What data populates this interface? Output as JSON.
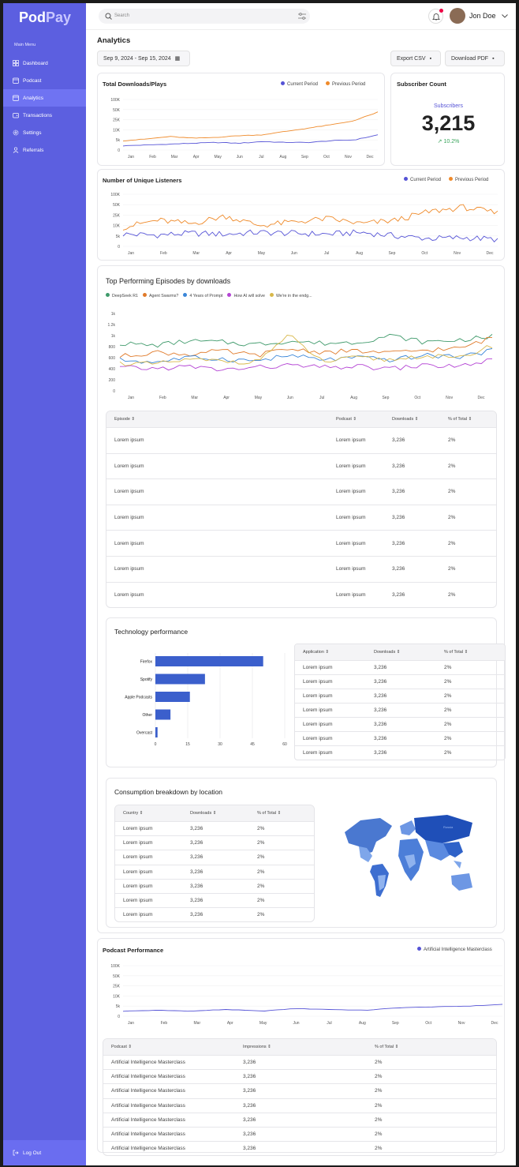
{
  "brand": {
    "name_a": "Pod",
    "name_b": "Pay"
  },
  "sidebar": {
    "menu_title": "Main Menu",
    "items": [
      {
        "label": "Dashboard"
      },
      {
        "label": "Podcast"
      },
      {
        "label": "Analytics"
      },
      {
        "label": "Transactions"
      },
      {
        "label": "Settings"
      },
      {
        "label": "Referrals"
      }
    ],
    "logout": "Log Out"
  },
  "header": {
    "search_placeholder": "Search",
    "user_name": "Jon Doe"
  },
  "page": {
    "title": "Analytics",
    "date_range": "Sep 9, 2024 - Sep 15, 2024",
    "export_csv": "Export CSV",
    "download_pdf": "Download PDF"
  },
  "months": [
    "Jan",
    "Feb",
    "Mar",
    "Apr",
    "May",
    "Jun",
    "Jul",
    "Aug",
    "Sep",
    "Oct",
    "Nov",
    "Dec"
  ],
  "downloads": {
    "title": "Total Downloads/Plays",
    "legend": [
      "Current Period",
      "Previous Period"
    ],
    "yticks": [
      "100K",
      "50K",
      "25K",
      "10K",
      "5k",
      "0"
    ]
  },
  "subscribers": {
    "title": "Subscriber Count",
    "label": "Subscribers",
    "value": "3,215",
    "change": "10.2%"
  },
  "listeners": {
    "title": "Number of Unique Listeners",
    "legend": [
      "Current Period",
      "Previous Period"
    ],
    "yticks": [
      "100K",
      "50K",
      "25K",
      "10K",
      "5k",
      "0"
    ]
  },
  "episodes": {
    "title": "Top Performing Episodes by downloads",
    "legend": [
      "DeepSeek R1",
      "Agent Swarms?",
      "4 Years of Prompt",
      "How AI will solve",
      "We're in the endg..."
    ],
    "yticks": [
      "1k",
      "1.2k",
      "1k",
      "800",
      "600",
      "400",
      "200",
      "0"
    ],
    "table": {
      "headers": [
        "Episode",
        "Podcast",
        "Downloads",
        "% of Total"
      ],
      "rows": [
        [
          "Lorem ipsum",
          "Lorem ipsum",
          "3,236",
          "2%"
        ],
        [
          "Lorem ipsum",
          "Lorem ipsum",
          "3,236",
          "2%"
        ],
        [
          "Lorem ipsum",
          "Lorem ipsum",
          "3,236",
          "2%"
        ],
        [
          "Lorem ipsum",
          "Lorem ipsum",
          "3,236",
          "2%"
        ],
        [
          "Lorem ipsum",
          "Lorem ipsum",
          "3,236",
          "2%"
        ],
        [
          "Lorem ipsum",
          "Lorem ipsum",
          "3,236",
          "2%"
        ],
        [
          "Lorem ipsum",
          "Lorem ipsum",
          "3,236",
          "2%"
        ]
      ]
    }
  },
  "technology": {
    "title": "Technology performance",
    "xticks": [
      "0",
      "15",
      "30",
      "45",
      "60"
    ],
    "table": {
      "headers": [
        "Application",
        "Downloads",
        "% of Total"
      ],
      "rows": [
        [
          "Lorem ipsum",
          "3,236",
          "2%"
        ],
        [
          "Lorem ipsum",
          "3,236",
          "2%"
        ],
        [
          "Lorem ipsum",
          "3,236",
          "2%"
        ],
        [
          "Lorem ipsum",
          "3,236",
          "2%"
        ],
        [
          "Lorem ipsum",
          "3,236",
          "2%"
        ],
        [
          "Lorem ipsum",
          "3,236",
          "2%"
        ],
        [
          "Lorem ipsum",
          "3,236",
          "2%"
        ]
      ]
    }
  },
  "location": {
    "title": "Consumption breakdown by location",
    "map_label": "Russia",
    "table": {
      "headers": [
        "Country",
        "Downloads",
        "% of Total"
      ],
      "rows": [
        [
          "Lorem ipsum",
          "3,236",
          "2%"
        ],
        [
          "Lorem ipsum",
          "3,236",
          "2%"
        ],
        [
          "Lorem ipsum",
          "3,236",
          "2%"
        ],
        [
          "Lorem ipsum",
          "3,236",
          "2%"
        ],
        [
          "Lorem ipsum",
          "3,236",
          "2%"
        ],
        [
          "Lorem ipsum",
          "3,236",
          "2%"
        ],
        [
          "Lorem ipsum",
          "3,236",
          "2%"
        ]
      ]
    }
  },
  "performance": {
    "title": "Podcast Performance",
    "legend": [
      "Artificial Intelligence Masterclass"
    ],
    "yticks": [
      "100K",
      "50K",
      "25K",
      "10K",
      "5k",
      "0"
    ],
    "table": {
      "headers": [
        "Podcast",
        "Impressions",
        "% of Total"
      ],
      "rows": [
        [
          "Artificial Intelligence Masterclass",
          "3,236",
          "2%"
        ],
        [
          "Artificial Intelligence Masterclass",
          "3,236",
          "2%"
        ],
        [
          "Artificial Intelligence Masterclass",
          "3,236",
          "2%"
        ],
        [
          "Artificial Intelligence Masterclass",
          "3,236",
          "2%"
        ],
        [
          "Artificial Intelligence Masterclass",
          "3,236",
          "2%"
        ],
        [
          "Artificial Intelligence Masterclass",
          "3,236",
          "2%"
        ],
        [
          "Artificial Intelligence Masterclass",
          "3,236",
          "2%"
        ]
      ]
    }
  },
  "chart_data": [
    {
      "type": "line",
      "title": "Total Downloads/Plays",
      "x": [
        "Jan",
        "Feb",
        "Mar",
        "Apr",
        "May",
        "Jun",
        "Jul",
        "Aug",
        "Sep",
        "Oct",
        "Nov",
        "Dec"
      ],
      "series": [
        {
          "name": "Current Period",
          "color": "#5553d6",
          "values": [
            5,
            6,
            7,
            8,
            9,
            8,
            10,
            9,
            9,
            11,
            12,
            18
          ]
        },
        {
          "name": "Previous Period",
          "color": "#ef8a2a",
          "values": [
            11,
            13,
            16,
            14,
            15,
            17,
            18,
            22,
            26,
            30,
            35,
            45
          ]
        }
      ]
    },
    {
      "type": "line",
      "title": "Number of Unique Listeners",
      "x": [
        "Jan",
        "Feb",
        "Mar",
        "Apr",
        "May",
        "Jun",
        "Jul",
        "Aug",
        "Sep",
        "Oct",
        "Nov",
        "Dec"
      ],
      "series": [
        {
          "name": "Current Period",
          "color": "#5553d6",
          "values": [
            14,
            13,
            15,
            14,
            16,
            15,
            14,
            16,
            12,
            9,
            10,
            8
          ]
        },
        {
          "name": "Previous Period",
          "color": "#ef8a2a",
          "values": [
            22,
            30,
            26,
            35,
            24,
            28,
            32,
            26,
            30,
            40,
            45,
            38
          ]
        }
      ]
    },
    {
      "type": "bar",
      "orientation": "horizontal",
      "title": "Technology performance",
      "categories": [
        "Firefox",
        "Spotify",
        "Apple Podcasts",
        "Other",
        "Overcast"
      ],
      "values": [
        50,
        23,
        16,
        7,
        1
      ],
      "xlim": [
        0,
        60
      ]
    },
    {
      "type": "line",
      "title": "Podcast Performance",
      "x": [
        "Jan",
        "Feb",
        "Mar",
        "Apr",
        "May",
        "Jun",
        "Jul",
        "Aug",
        "Sep",
        "Oct",
        "Nov",
        "Dec"
      ],
      "series": [
        {
          "name": "Artificial Intelligence Masterclass",
          "color": "#5553d6",
          "values": [
            6,
            7,
            6,
            8,
            6,
            9,
            8,
            7,
            10,
            11,
            12,
            14
          ]
        }
      ]
    }
  ]
}
